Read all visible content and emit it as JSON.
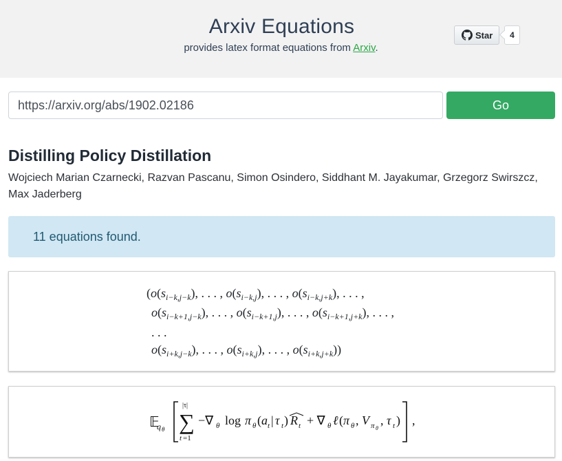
{
  "header": {
    "title": "Arxiv Equations",
    "subtitle_prefix": "provides latex format equations from ",
    "subtitle_link": "Arxiv",
    "subtitle_suffix": ".",
    "star_label": "Star",
    "star_count": "4"
  },
  "search": {
    "value": "https://arxiv.org/abs/1902.02186",
    "go_label": "Go"
  },
  "paper": {
    "title": "Distilling Policy Distillation",
    "authors": "Wojciech Marian Czarnecki, Razvan Pascanu, Simon Osindero, Siddhant M. Jayakumar, Grzegorz Swirszcz, Max Jaderberg"
  },
  "alert": {
    "text": "11 equations found."
  },
  "equations": {
    "eq1": {
      "line1": "(o(si−k,j−k), . . . , o(si−k,j), . . . , o(si−k,j+k), . . . ,",
      "line2": "o(si−k+1,j−k), . . . , o(si−k+1,j), . . . , o(si−k+1,j+k), . . . ,",
      "line3": ". . .",
      "line4": "o(si+k,j−k), . . . , o(si+k,j), . . . , o(si+k,j+k))"
    },
    "eq2": {
      "text": "𝔼qθ [ Σt=1|τ| −∇θ log πθ(at|τt)R̂t + ∇θℓ(πθ, Vπθ, τt) ] ,"
    }
  },
  "colors": {
    "header_bg": "#f2f2f2",
    "go_button": "#34a963",
    "alert_bg": "#d1e7f3",
    "link": "#28a745"
  },
  "icons": [
    "github-icon"
  ]
}
